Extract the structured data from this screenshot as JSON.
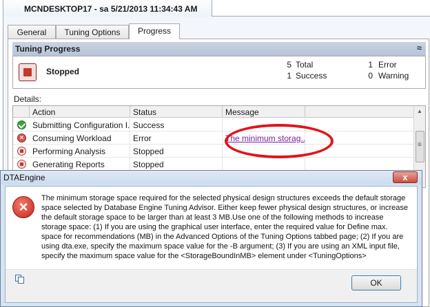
{
  "session": {
    "title": "MCNDESKTOP17 - sa 5/21/2013 11:34:43 AM"
  },
  "tabs": [
    {
      "label": "General",
      "active": false
    },
    {
      "label": "Tuning Options",
      "active": false
    },
    {
      "label": "Progress",
      "active": true
    }
  ],
  "tuning_progress": {
    "header": "Tuning Progress",
    "collapse_glyph": "≈",
    "status": "Stopped",
    "metrics": [
      {
        "value": "5",
        "label": "Total"
      },
      {
        "value": "1",
        "label": "Success"
      },
      {
        "value": "1",
        "label": "Error"
      },
      {
        "value": "0",
        "label": "Warning"
      }
    ]
  },
  "details": {
    "label": "Details:",
    "columns": [
      "Action",
      "Status",
      "Message"
    ],
    "rows": [
      {
        "icon": "success-check-icon",
        "action": "Submitting Configuration I...",
        "status": "Success",
        "message": ""
      },
      {
        "icon": "error-x-icon",
        "action": "Consuming Workload",
        "status": "Error",
        "message": "The minimum storag..."
      },
      {
        "icon": "stop-icon",
        "action": "Performing Analysis",
        "status": "Stopped",
        "message": ""
      },
      {
        "icon": "stop-icon",
        "action": "Generating Reports",
        "status": "Stopped",
        "message": ""
      }
    ]
  },
  "dialog": {
    "title": "DTAEngine",
    "close_label": "x",
    "message": "The minimum storage space required for the selected physical design structures exceeds the default storage space selected by Database Engine Tuning Advisor. Either keep fewer physical design structures, or increase the default storage space to be larger than at least 3 MB.Use one of the following methods to increase storage space: (1) If you are using the graphical user interface, enter the required value for Define max. space for recommendations (MB) in the Advanced Options of the Tuning Options tabbed page; (2) If you are using dta.exe, specify the maximum space value for the -B argument; (3) If you are using an XML input file, specify the maximum space value for the <StorageBoundInMB> element under <TuningOptions>",
    "ok_label": "OK"
  },
  "colors": {
    "annotation_circle": "#e0141b",
    "link": "#7a1fa2",
    "section_header": "#bfcbdc",
    "dialog_frame": "#d7e4f2"
  }
}
